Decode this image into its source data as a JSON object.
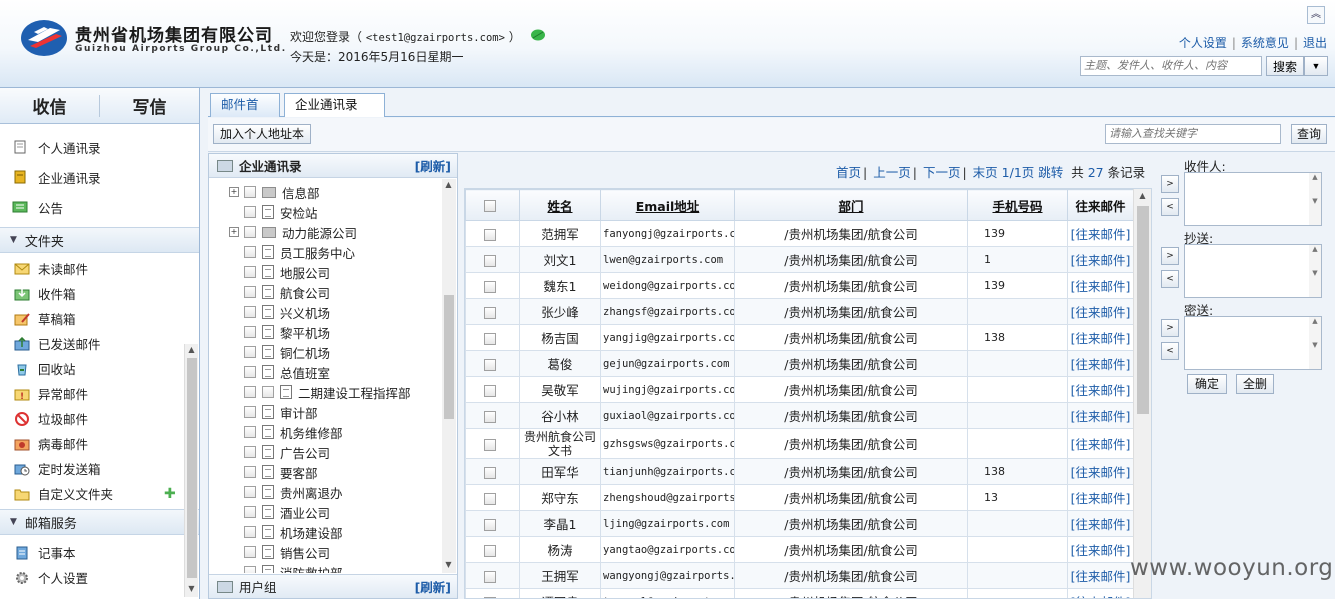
{
  "header": {
    "brand_cn": "贵州省机场集团有限公司",
    "brand_en": "Guizhou Airports Group Co.,Ltd.",
    "welcome_prefix": "欢迎您登录（",
    "user_email": "<test1@gzairports.com>",
    "welcome_suffix": "）",
    "today": "今天是：2016年5月16日星期一",
    "links": [
      "个人设置",
      "系统意见",
      "退出"
    ],
    "search_placeholder": "主题、发件人、收件人、内容",
    "search_button": "搜索",
    "collapse_icon": "double-chevron-up"
  },
  "sidebar": {
    "tabs": [
      "收信",
      "写信"
    ],
    "top_items": [
      {
        "label": "个人通讯录",
        "icon": "address-book-icon"
      },
      {
        "label": "企业通讯录",
        "icon": "corporate-book-icon"
      },
      {
        "label": "公告",
        "icon": "announcement-icon"
      }
    ],
    "folder_section": "文件夹",
    "folders": [
      {
        "label": "未读邮件",
        "icon": "unread-mail-icon"
      },
      {
        "label": "收件箱",
        "icon": "inbox-icon"
      },
      {
        "label": "草稿箱",
        "icon": "drafts-icon"
      },
      {
        "label": "已发送邮件",
        "icon": "sent-icon"
      },
      {
        "label": "回收站",
        "icon": "recycle-bin-icon"
      },
      {
        "label": "异常邮件",
        "icon": "exception-mail-icon"
      },
      {
        "label": "垃圾邮件",
        "icon": "spam-icon"
      },
      {
        "label": "病毒邮件",
        "icon": "virus-mail-icon"
      },
      {
        "label": "定时发送箱",
        "icon": "scheduled-send-icon"
      },
      {
        "label": "自定义文件夹",
        "icon": "custom-folder-icon"
      }
    ],
    "service_section": "邮箱服务",
    "services": [
      {
        "label": "记事本",
        "icon": "notepad-icon"
      },
      {
        "label": "个人设置",
        "icon": "settings-gear-icon"
      }
    ]
  },
  "tabs": [
    {
      "label": "邮件首页",
      "active": false
    },
    {
      "label": "企业通讯录",
      "active": true
    }
  ],
  "toolbar": {
    "add_button": "加入个人地址本",
    "keyword_placeholder": "请输入查找关键字",
    "query_button": "查询"
  },
  "tree": {
    "title": "企业通讯录",
    "refresh": "[刷新]",
    "nodes": [
      {
        "label": "信息部",
        "type": "folder",
        "expandable": true
      },
      {
        "label": "安检站",
        "type": "doc"
      },
      {
        "label": "动力能源公司",
        "type": "folder",
        "expandable": true
      },
      {
        "label": "员工服务中心",
        "type": "doc"
      },
      {
        "label": "地服公司",
        "type": "doc"
      },
      {
        "label": "航食公司",
        "type": "doc"
      },
      {
        "label": "兴义机场",
        "type": "doc"
      },
      {
        "label": "黎平机场",
        "type": "doc"
      },
      {
        "label": "铜仁机场",
        "type": "doc"
      },
      {
        "label": "总值班室",
        "type": "doc"
      },
      {
        "label": "二期建设工程指挥部",
        "type": "doc",
        "double": true
      },
      {
        "label": "审计部",
        "type": "doc"
      },
      {
        "label": "机务维修部",
        "type": "doc"
      },
      {
        "label": "广告公司",
        "type": "doc"
      },
      {
        "label": "要客部",
        "type": "doc"
      },
      {
        "label": "贵州离退办",
        "type": "doc"
      },
      {
        "label": "酒业公司",
        "type": "doc"
      },
      {
        "label": "机场建设部",
        "type": "doc"
      },
      {
        "label": "销售公司",
        "type": "doc"
      },
      {
        "label": "消防救护部",
        "type": "doc"
      }
    ],
    "footer": "用户组",
    "footer_refresh": "[刷新]"
  },
  "pager": {
    "first": "首页",
    "prev": "上一页",
    "next": "下一页",
    "last": "末页",
    "page": "1/1页",
    "jump": "跳转",
    "total_prefix": "共",
    "total": "27",
    "total_suffix": "条记录"
  },
  "table": {
    "columns": [
      "姓名",
      "Email地址",
      "部门",
      "手机号码",
      "往来邮件"
    ],
    "rows": [
      {
        "name": "范拥军",
        "email": "fanyongj@gzairports.com",
        "dept": "/贵州机场集团/航食公司",
        "phone": "139",
        "mail": "[往来邮件]"
      },
      {
        "name": "刘文1",
        "email": "lwen@gzairports.com",
        "dept": "/贵州机场集团/航食公司",
        "phone": "1",
        "mail": "[往来邮件]"
      },
      {
        "name": "魏东1",
        "email": "weidong@gzairports.com",
        "dept": "/贵州机场集团/航食公司",
        "phone": "139",
        "mail": "[往来邮件]"
      },
      {
        "name": "张少峰",
        "email": "zhangsf@gzairports.com",
        "dept": "/贵州机场集团/航食公司",
        "phone": "",
        "mail": "[往来邮件]"
      },
      {
        "name": "杨吉国",
        "email": "yangjig@gzairports.com",
        "dept": "/贵州机场集团/航食公司",
        "phone": "138",
        "mail": "[往来邮件]"
      },
      {
        "name": "葛俊",
        "email": "gejun@gzairports.com",
        "dept": "/贵州机场集团/航食公司",
        "phone": "",
        "mail": "[往来邮件]"
      },
      {
        "name": "吴敬军",
        "email": "wujingj@gzairports.com",
        "dept": "/贵州机场集团/航食公司",
        "phone": "",
        "mail": "[往来邮件]"
      },
      {
        "name": "谷小林",
        "email": "guxiaol@gzairports.com",
        "dept": "/贵州机场集团/航食公司",
        "phone": "",
        "mail": "[往来邮件]"
      },
      {
        "name": "贵州航食公司文书",
        "email": "gzhsgsws@gzairports.com",
        "dept": "/贵州机场集团/航食公司",
        "phone": "",
        "mail": "[往来邮件]"
      },
      {
        "name": "田军华",
        "email": "tianjunh@gzairports.com",
        "dept": "/贵州机场集团/航食公司",
        "phone": "138",
        "mail": "[往来邮件]"
      },
      {
        "name": "郑守东",
        "email": "zhengshoud@gzairports.com",
        "dept": "/贵州机场集团/航食公司",
        "phone": "13",
        "mail": "[往来邮件]"
      },
      {
        "name": "李晶1",
        "email": "ljing@gzairports.com",
        "dept": "/贵州机场集团/航食公司",
        "phone": "",
        "mail": "[往来邮件]"
      },
      {
        "name": "杨涛",
        "email": "yangtao@gzairports.com",
        "dept": "/贵州机场集团/航食公司",
        "phone": "",
        "mail": "[往来邮件]"
      },
      {
        "name": "王拥军",
        "email": "wangyongj@gzairports.com",
        "dept": "/贵州机场集团/航食公司",
        "phone": "",
        "mail": "[往来邮件]"
      },
      {
        "name": "谭国良",
        "email": "tanguol@gzairports.com",
        "dept": "/贵州机场集团/航食公司",
        "phone": "",
        "mail": "[往来邮件]"
      }
    ]
  },
  "recipients": {
    "to_label": "收件人:",
    "cc_label": "抄送:",
    "bcc_label": "密送:",
    "confirm": "确定",
    "delete_all": "全删"
  },
  "watermark": "www.wooyun.org"
}
